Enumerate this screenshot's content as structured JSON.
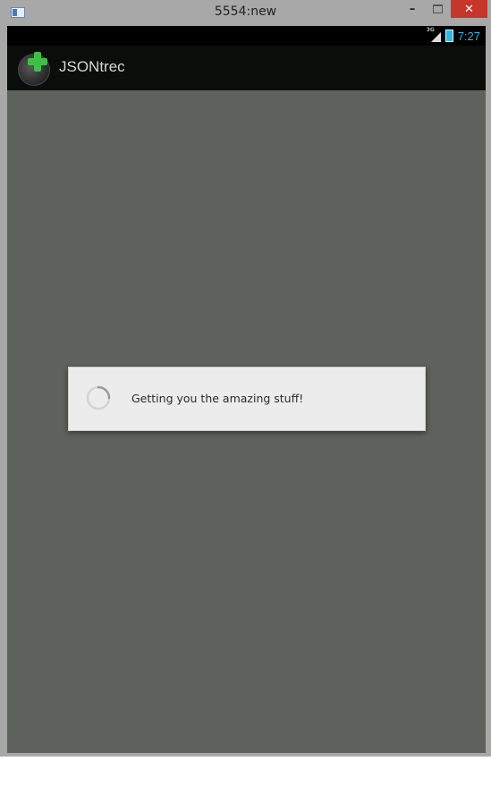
{
  "window": {
    "title": "5554:new",
    "minimize_glyph": "–",
    "close_glyph": "✕"
  },
  "status_bar": {
    "network_label": "3G",
    "time": "7:27"
  },
  "action_bar": {
    "app_title": "JSONtrec",
    "app_icon": "plus-badge-icon"
  },
  "dialog": {
    "message": "Getting you the amazing stuff!"
  },
  "colors": {
    "accent": "#33b5e5",
    "app_icon_green": "#3fbf4a",
    "dim_background": "#5f615d"
  }
}
